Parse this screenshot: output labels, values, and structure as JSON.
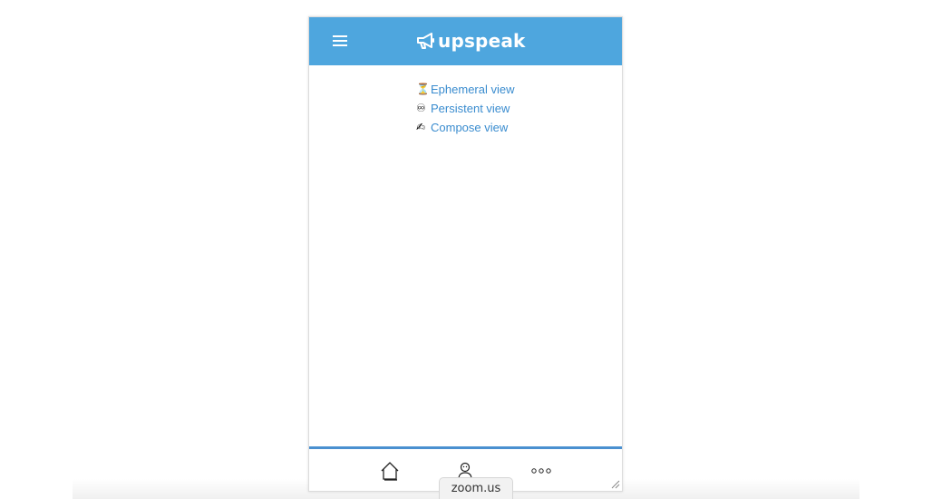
{
  "header": {
    "brand": "upspeak",
    "brand_icon": "megaphone-icon",
    "menu_icon": "hamburger-menu-icon",
    "background_color": "#4ea6de"
  },
  "views": [
    {
      "emoji": "⏳",
      "icon": "hourglass-icon",
      "label": "Ephemeral view"
    },
    {
      "emoji": "♾",
      "icon": "infinity-icon",
      "label": "Persistent view"
    },
    {
      "emoji": "✍",
      "icon": "writing-hand-icon",
      "label": "Compose view"
    }
  ],
  "link_color": "#3a8ccf",
  "bottom_nav": {
    "items": [
      {
        "icon": "home-icon"
      },
      {
        "icon": "profile-icon"
      },
      {
        "icon": "more-icon"
      }
    ],
    "accent_color": "#4a90d0"
  },
  "overlay": {
    "label": "zoom.us"
  }
}
